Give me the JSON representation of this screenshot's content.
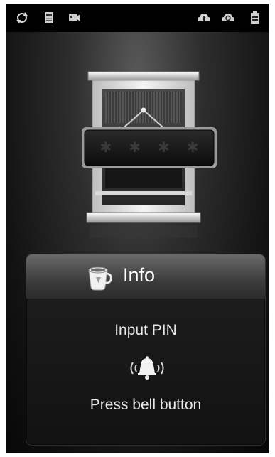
{
  "status_bar": {
    "left_icons": [
      "sync-icon",
      "sd-card-icon",
      "video-camera-icon"
    ],
    "right_icons": [
      "upload-cloud-icon",
      "sync-cloud-icon",
      "battery-icon"
    ]
  },
  "pin_entry": {
    "mask_glyphs": [
      "✱",
      "✱",
      "✱",
      "✱"
    ]
  },
  "info_panel": {
    "icon": "coffee-cup-icon",
    "title": "Info",
    "instruction_pin": "Input PIN",
    "bell_icon": "bell-ringing-icon",
    "instruction_bell": "Press bell button"
  }
}
